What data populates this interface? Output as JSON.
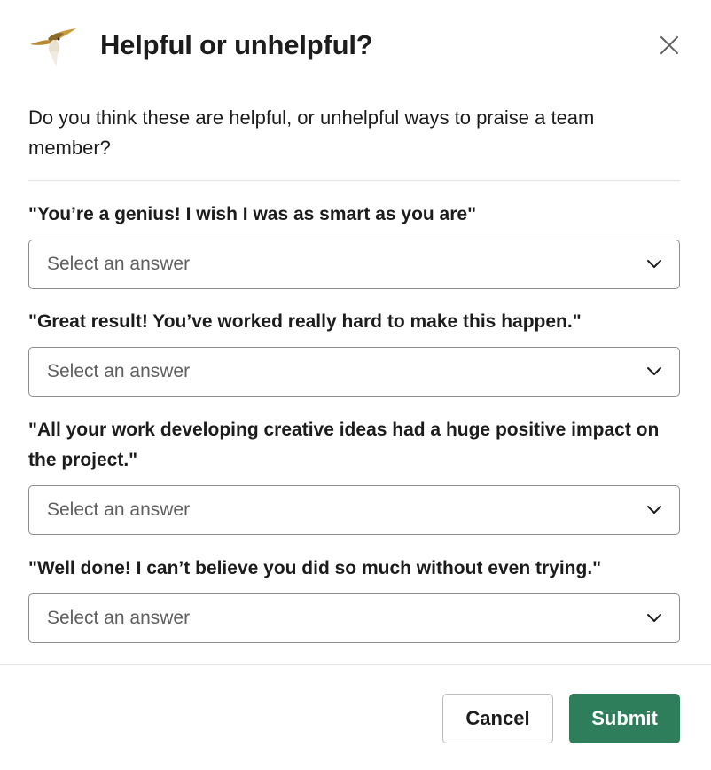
{
  "modal": {
    "title": "Helpful or unhelpful?",
    "app_icon": "hummingbird-icon",
    "close_icon": "close-icon",
    "intro": "Do you think these are helpful, or unhelpful ways to praise a team member?"
  },
  "questions": [
    {
      "prompt": "\"You’re a genius! I wish I was as smart as you are\"",
      "placeholder": "Select an answer"
    },
    {
      "prompt": "\"Great result! You’ve worked really hard to make this happen.\"",
      "placeholder": "Select an answer"
    },
    {
      "prompt": "\"All your work developing creative ideas had a huge positive impact on the project.\"",
      "placeholder": "Select an answer"
    },
    {
      "prompt": "\"Well done! I can’t believe you did so much without even trying.\"",
      "placeholder": "Select an answer"
    }
  ],
  "footer": {
    "cancel_label": "Cancel",
    "submit_label": "Submit"
  },
  "colors": {
    "submit": "#2e7d5b",
    "border": "#8d8d8f",
    "placeholder": "#616061"
  }
}
